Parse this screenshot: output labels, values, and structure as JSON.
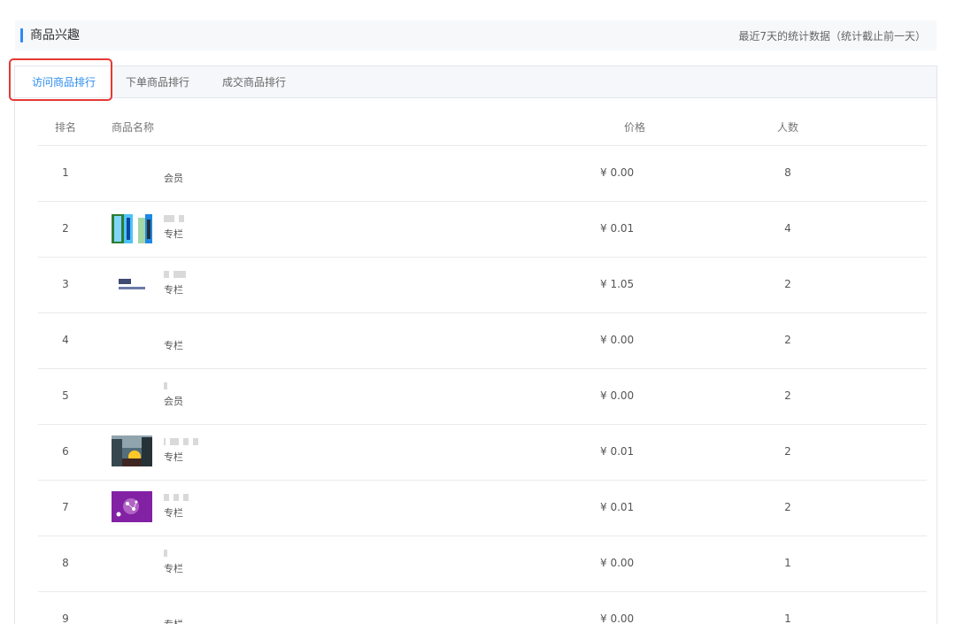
{
  "section": {
    "title": "商品兴趣",
    "note": "最近7天的统计数据（统计截止前一天）",
    "accent_color": "#2d8cf0"
  },
  "tabs": [
    {
      "label": "访问商品排行",
      "active": true
    },
    {
      "label": "下单商品排行",
      "active": false
    },
    {
      "label": "成交商品排行",
      "active": false
    }
  ],
  "highlight_color": "#e53935",
  "table": {
    "headers": {
      "rank": "排名",
      "name": "商品名称",
      "price": "价格",
      "count": "人数"
    },
    "rows": [
      {
        "rank": "1",
        "thumb": "none",
        "type": "会员",
        "price": "¥ 0.00",
        "count": "8"
      },
      {
        "rank": "2",
        "thumb": "waterfall-image",
        "type": "专栏",
        "price": "¥ 0.01",
        "count": "4"
      },
      {
        "rank": "3",
        "thumb": "text-logo-image",
        "type": "专栏",
        "price": "¥ 1.05",
        "count": "2"
      },
      {
        "rank": "4",
        "thumb": "none",
        "type": "专栏",
        "price": "¥ 0.00",
        "count": "2"
      },
      {
        "rank": "5",
        "thumb": "none",
        "type": "会员",
        "price": "¥ 0.00",
        "count": "2"
      },
      {
        "rank": "6",
        "thumb": "city-sunset-image",
        "type": "专栏",
        "price": "¥ 0.01",
        "count": "2"
      },
      {
        "rank": "7",
        "thumb": "purple-network-image",
        "type": "专栏",
        "price": "¥ 0.01",
        "count": "2"
      },
      {
        "rank": "8",
        "thumb": "none",
        "type": "专栏",
        "price": "¥ 0.00",
        "count": "1"
      },
      {
        "rank": "9",
        "thumb": "none",
        "type": "专栏",
        "price": "¥ 0.00",
        "count": "1"
      }
    ]
  }
}
